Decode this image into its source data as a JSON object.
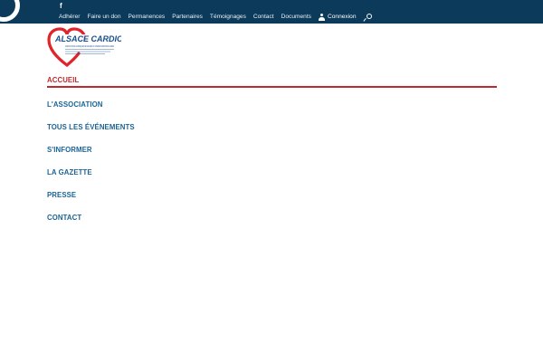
{
  "topbar": {
    "social": {
      "facebook_label": "f",
      "icon": "facebook-icon"
    },
    "nav": [
      "Adhérer",
      "Faire un don",
      "Permanences",
      "Partenaires",
      "Témoignages",
      "Contact",
      "Documents"
    ],
    "login_label": "Connexion",
    "login_icon": "user-icon",
    "search_icon": "search-icon",
    "background_color": "#0b3a5a"
  },
  "logo": {
    "text": "ALSACE CARDIO",
    "subtext": "ASSOCIATION DE CARDIAQUES DE MALADES OU OPERES CARDIOVASCULAIRES",
    "heart_color": "#e0242b"
  },
  "menu": {
    "items": [
      "ACCUEIL",
      "L'ASSOCIATION",
      "TOUS LES ÉVÉNEMENTS",
      "S'INFORMER",
      "LA GAZETTE",
      "PRESSE",
      "CONTACT"
    ],
    "active_index": 0,
    "link_color": "#1a6496",
    "active_color": "#c0282d"
  }
}
